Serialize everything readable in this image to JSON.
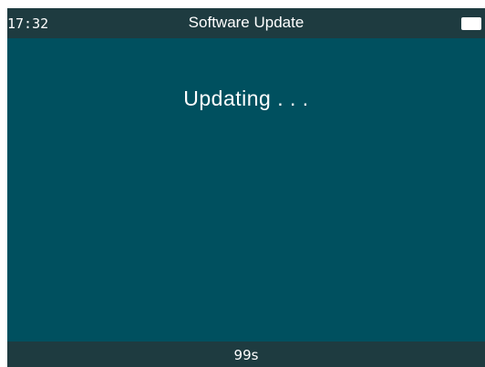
{
  "status_bar": {
    "time": "17:32",
    "title": "Software Update",
    "battery_icon": "battery-icon"
  },
  "main": {
    "message": "Updating . . ."
  },
  "bottom_bar": {
    "countdown": "99s"
  },
  "colors": {
    "screen_background": "#00505f",
    "bar_background": "#1e3b40",
    "text": "#ffffff"
  }
}
